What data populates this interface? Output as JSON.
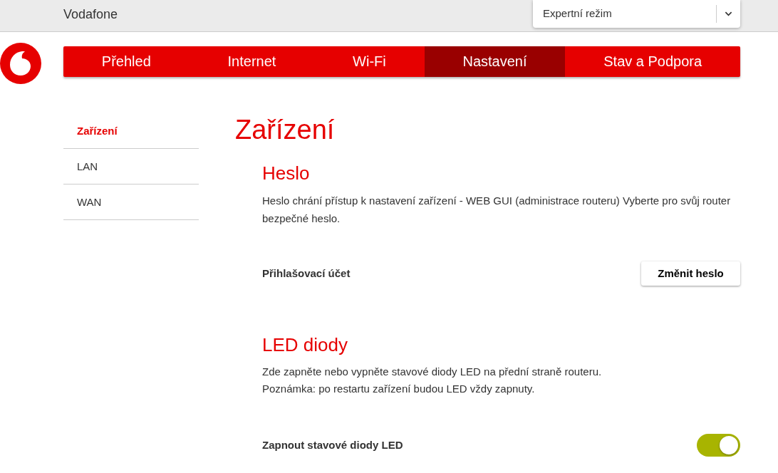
{
  "header": {
    "brand": "Vodafone",
    "mode_select": {
      "value": "Expertní režim"
    }
  },
  "nav": [
    {
      "label": "Přehled",
      "selected": false
    },
    {
      "label": "Internet",
      "selected": false
    },
    {
      "label": "Wi-Fi",
      "selected": false
    },
    {
      "label": "Nastavení",
      "selected": true
    },
    {
      "label": "Stav a Podpora",
      "selected": false
    }
  ],
  "sidebar": [
    {
      "label": "Zařízení",
      "selected": true
    },
    {
      "label": "LAN",
      "selected": false
    },
    {
      "label": "WAN",
      "selected": false
    }
  ],
  "page_title": "Zařízení",
  "sections": [
    {
      "title": "Heslo",
      "paragraphs": [
        "Heslo chrání přístup k nastavení zařízení - WEB GUI (administrace routeru) Vyberte pro svůj router bezpečné heslo."
      ],
      "rows": [
        {
          "kind": "button",
          "label": "Přihlašovací účet",
          "button": "Změnit heslo"
        }
      ]
    },
    {
      "title": "LED diody",
      "paragraphs": [
        "Zde zapněte nebo vypněte stavové diody LED na přední straně routeru.",
        "Poznámka: po restartu zařízení budou LED vždy zapnuty."
      ],
      "rows": [
        {
          "kind": "toggle",
          "label": "Zapnout stavové diody LED",
          "on": true
        }
      ]
    }
  ]
}
